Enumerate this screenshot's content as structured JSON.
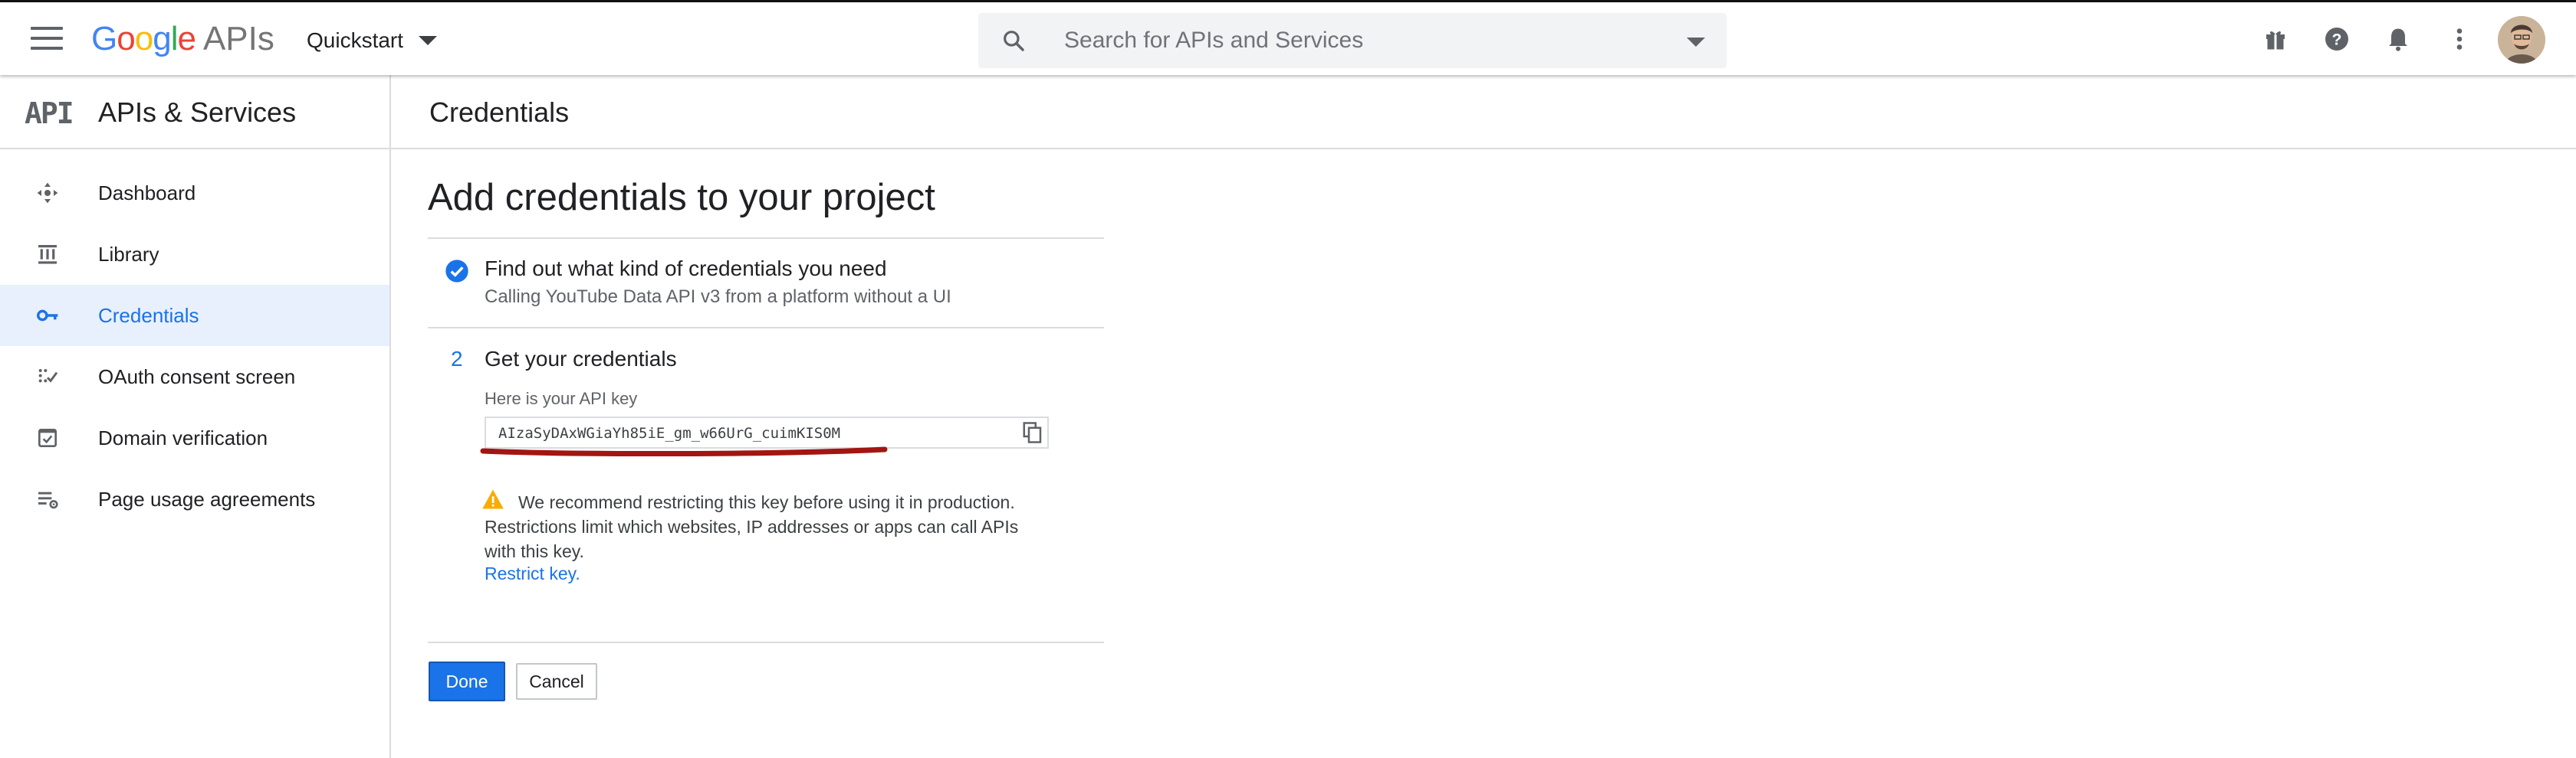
{
  "header": {
    "logo_text": "Google",
    "logo_suffix": "APIs",
    "project_name": "Quickstart",
    "search_placeholder": "Search for APIs and Services",
    "icons": [
      "hamburger-menu-icon",
      "gift-icon",
      "help-icon",
      "notifications-bell-icon",
      "more-vert-icon",
      "user-avatar"
    ]
  },
  "sidebar": {
    "mark": "API",
    "title": "APIs & Services",
    "items": [
      {
        "label": "Dashboard",
        "icon": "dashboard-icon",
        "active": false
      },
      {
        "label": "Library",
        "icon": "library-icon",
        "active": false
      },
      {
        "label": "Credentials",
        "icon": "key-icon",
        "active": true
      },
      {
        "label": "OAuth consent screen",
        "icon": "oauth-consent-icon",
        "active": false
      },
      {
        "label": "Domain verification",
        "icon": "domain-verification-icon",
        "active": false
      },
      {
        "label": "Page usage agreements",
        "icon": "page-usage-settings-icon",
        "active": false
      }
    ]
  },
  "page": {
    "header_title": "Credentials",
    "heading": "Add credentials to your project",
    "step1": {
      "title": "Find out what kind of credentials you need",
      "subtitle": "Calling YouTube Data API v3 from a platform without a UI"
    },
    "step2": {
      "number": "2",
      "title": "Get your credentials",
      "key_label": "Here is your API key",
      "api_key": "AIzaSyDAxWGiaYh85iE_gm_w66UrG_cuimKIS0M"
    },
    "warning": {
      "text": "We recommend restricting this key before using it in production. Restrictions limit which websites, IP addresses or apps can call APIs with this key.",
      "link": "Restrict key."
    },
    "buttons": {
      "done": "Done",
      "cancel": "Cancel"
    }
  },
  "colors": {
    "accent": "#1a73e8",
    "active_bg": "#e8f0fe",
    "warning": "#f9ab00",
    "annotation_underline": "#a31511"
  }
}
